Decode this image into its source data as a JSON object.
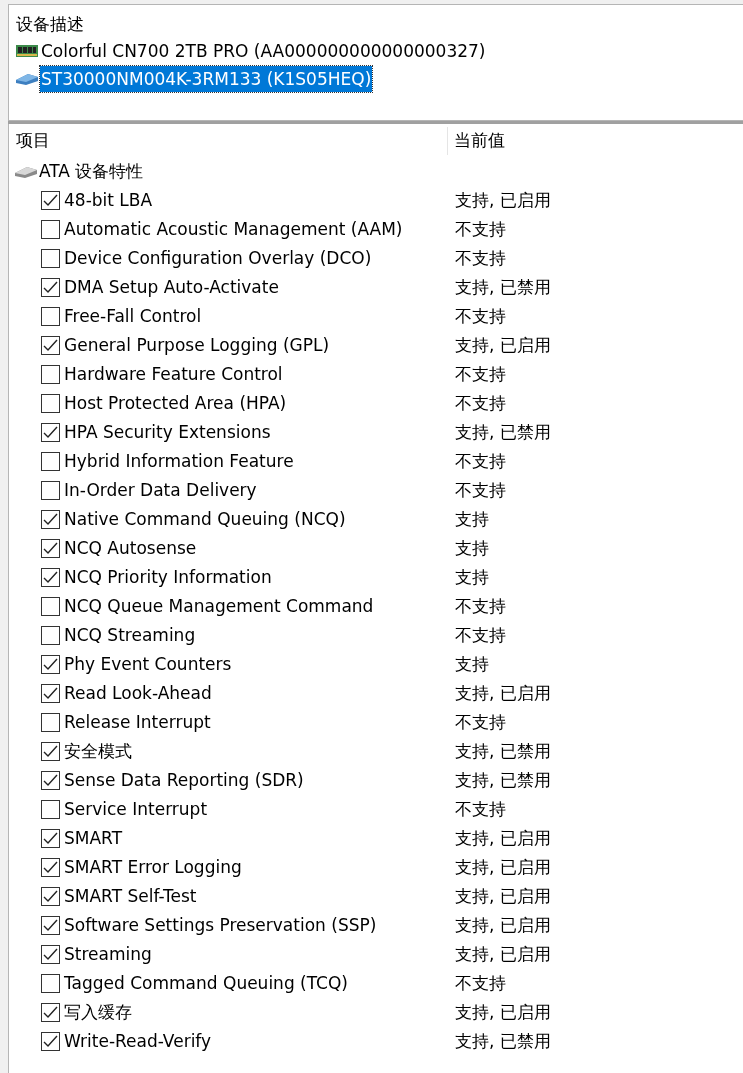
{
  "devices_panel": {
    "title": "设备描述",
    "devices": [
      {
        "kind": "nvme",
        "label": "Colorful CN700 2TB PRO (AA000000000000000327)",
        "selected": false
      },
      {
        "kind": "hdd",
        "label": "ST30000NM004K-3RM133 (K1S05HEQ)",
        "selected": true
      }
    ]
  },
  "table": {
    "columns": [
      "项目",
      "当前值"
    ],
    "group": {
      "label": "ATA 设备特性",
      "rows": [
        {
          "label": "48-bit LBA",
          "checked": true,
          "value": "支持, 已启用"
        },
        {
          "label": "Automatic Acoustic Management (AAM)",
          "checked": false,
          "value": "不支持"
        },
        {
          "label": "Device Configuration Overlay (DCO)",
          "checked": false,
          "value": "不支持"
        },
        {
          "label": "DMA Setup Auto-Activate",
          "checked": true,
          "value": "支持, 已禁用"
        },
        {
          "label": "Free-Fall Control",
          "checked": false,
          "value": "不支持"
        },
        {
          "label": "General Purpose Logging (GPL)",
          "checked": true,
          "value": "支持, 已启用"
        },
        {
          "label": "Hardware Feature Control",
          "checked": false,
          "value": "不支持"
        },
        {
          "label": "Host Protected Area (HPA)",
          "checked": false,
          "value": "不支持"
        },
        {
          "label": "HPA Security Extensions",
          "checked": true,
          "value": "支持, 已禁用"
        },
        {
          "label": "Hybrid Information Feature",
          "checked": false,
          "value": "不支持"
        },
        {
          "label": "In-Order Data Delivery",
          "checked": false,
          "value": "不支持"
        },
        {
          "label": "Native Command Queuing (NCQ)",
          "checked": true,
          "value": "支持"
        },
        {
          "label": "NCQ Autosense",
          "checked": true,
          "value": "支持"
        },
        {
          "label": "NCQ Priority Information",
          "checked": true,
          "value": "支持"
        },
        {
          "label": "NCQ Queue Management Command",
          "checked": false,
          "value": "不支持"
        },
        {
          "label": "NCQ Streaming",
          "checked": false,
          "value": "不支持"
        },
        {
          "label": "Phy Event Counters",
          "checked": true,
          "value": "支持"
        },
        {
          "label": "Read Look-Ahead",
          "checked": true,
          "value": "支持, 已启用"
        },
        {
          "label": "Release Interrupt",
          "checked": false,
          "value": "不支持"
        },
        {
          "label": "安全模式",
          "checked": true,
          "value": "支持, 已禁用"
        },
        {
          "label": "Sense Data Reporting (SDR)",
          "checked": true,
          "value": "支持, 已禁用"
        },
        {
          "label": "Service Interrupt",
          "checked": false,
          "value": "不支持"
        },
        {
          "label": "SMART",
          "checked": true,
          "value": "支持, 已启用"
        },
        {
          "label": "SMART Error Logging",
          "checked": true,
          "value": "支持, 已启用"
        },
        {
          "label": "SMART Self-Test",
          "checked": true,
          "value": "支持, 已启用"
        },
        {
          "label": "Software Settings Preservation (SSP)",
          "checked": true,
          "value": "支持, 已启用"
        },
        {
          "label": "Streaming",
          "checked": true,
          "value": "支持, 已启用"
        },
        {
          "label": "Tagged Command Queuing (TCQ)",
          "checked": false,
          "value": "不支持"
        },
        {
          "label": "写入缓存",
          "checked": true,
          "value": "支持, 已启用"
        },
        {
          "label": "Write-Read-Verify",
          "checked": true,
          "value": "支持, 已禁用"
        }
      ]
    }
  }
}
